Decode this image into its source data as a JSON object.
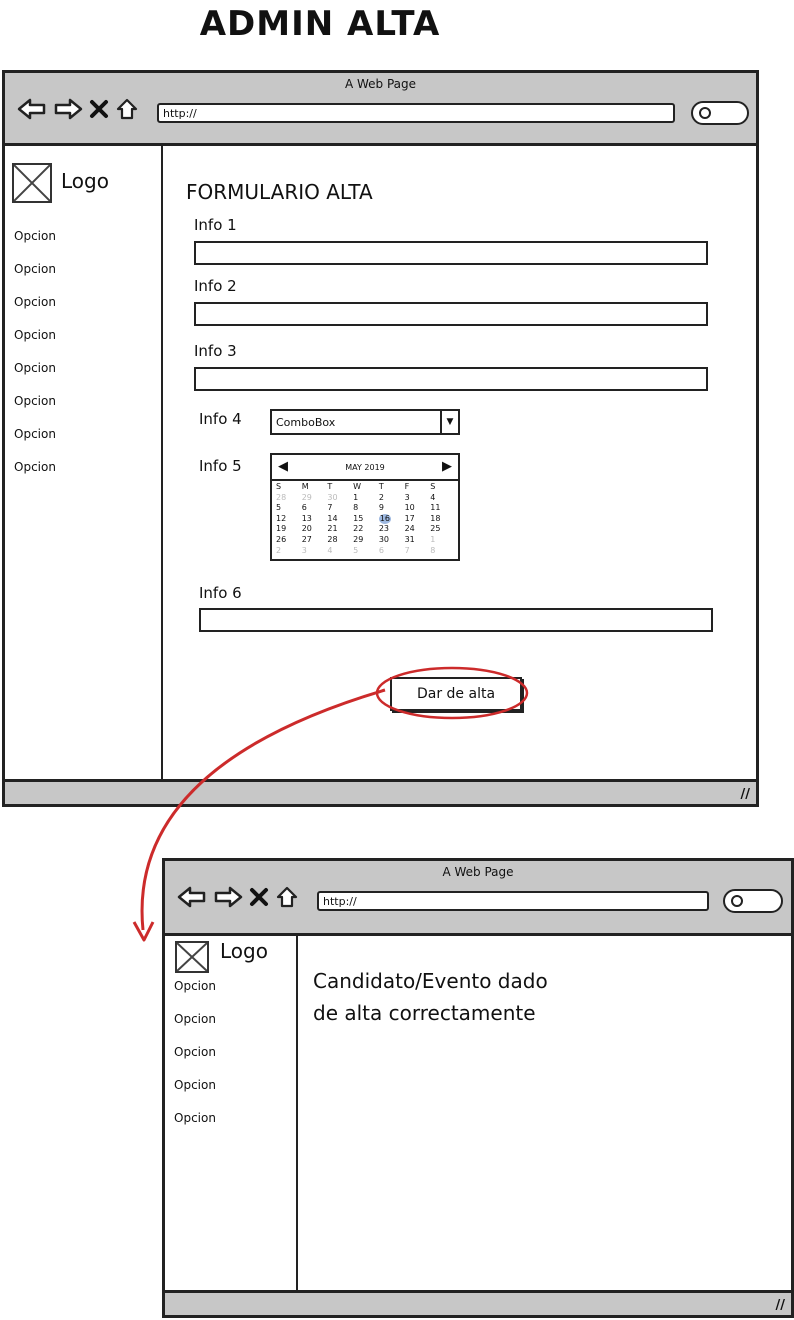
{
  "page_title": "ADMIN ALTA",
  "browser1": {
    "window_title": "A Web Page",
    "url": "http://",
    "logo": "Logo",
    "sidebar_items": [
      "Opcion",
      "Opcion",
      "Opcion",
      "Opcion",
      "Opcion",
      "Opcion",
      "Opcion",
      "Opcion"
    ],
    "form": {
      "title": "FORMULARIO ALTA",
      "info1": "Info 1",
      "info2": "Info 2",
      "info3": "Info 3",
      "info4": "Info 4",
      "combo_value": "ComboBox",
      "info5": "Info 5",
      "info6": "Info 6",
      "submit": "Dar de alta"
    },
    "calendar": {
      "month_label": "MAY 2019",
      "weekdays": [
        "S",
        "M",
        "T",
        "W",
        "T",
        "F",
        "S"
      ],
      "weeks": [
        [
          "28",
          "29",
          "30",
          "1",
          "2",
          "3",
          "4"
        ],
        [
          "5",
          "6",
          "7",
          "8",
          "9",
          "10",
          "11"
        ],
        [
          "12",
          "13",
          "14",
          "15",
          "16",
          "17",
          "18"
        ],
        [
          "19",
          "20",
          "21",
          "22",
          "23",
          "24",
          "25"
        ],
        [
          "26",
          "27",
          "28",
          "29",
          "30",
          "31",
          "1"
        ],
        [
          "2",
          "3",
          "4",
          "5",
          "6",
          "7",
          "8"
        ]
      ],
      "selected_day": "16"
    }
  },
  "browser2": {
    "window_title": "A Web Page",
    "url": "http://",
    "logo": "Logo",
    "sidebar_items": [
      "Opcion",
      "Opcion",
      "Opcion",
      "Opcion",
      "Opcion"
    ],
    "message_line1": "Candidato/Evento dado",
    "message_line2": "de alta correctamente"
  },
  "colors": {
    "flow_arrow": "#cc2b2b",
    "selected_day_bg": "#9db8e0",
    "chrome": "#c7c7c7"
  },
  "icons": [
    "back-arrow-icon",
    "forward-arrow-icon",
    "close-icon",
    "home-icon",
    "search-icon",
    "image-placeholder-icon",
    "dropdown-arrow-icon",
    "resize-grip-icon"
  ]
}
